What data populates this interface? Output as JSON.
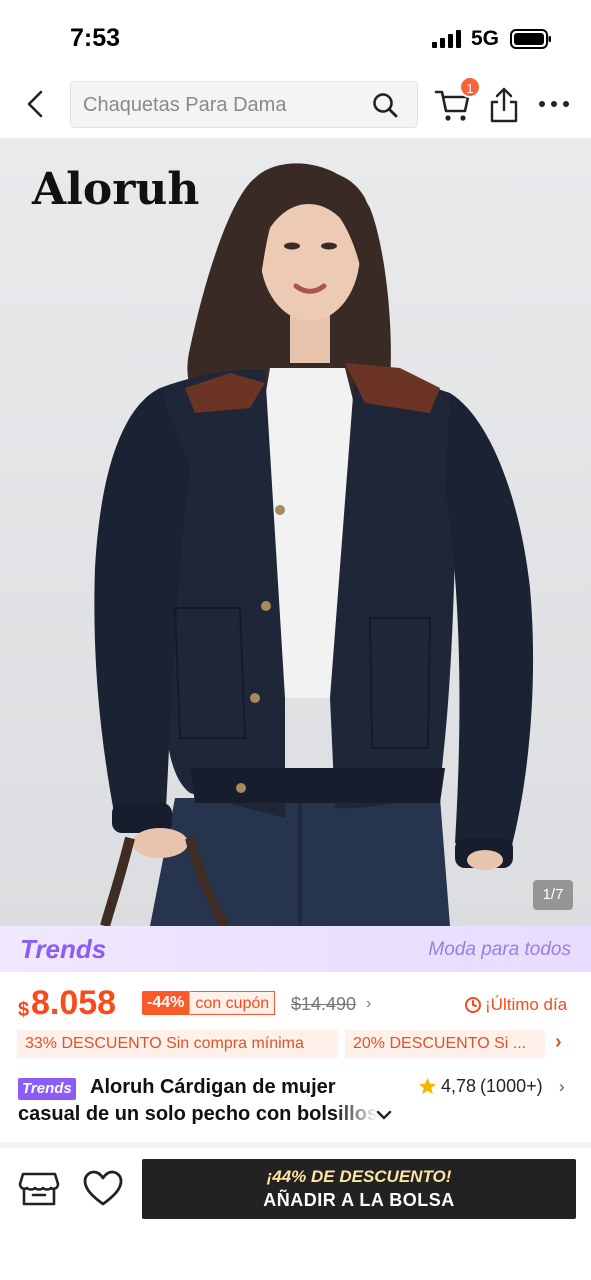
{
  "status_bar": {
    "time": "7:53",
    "network": "5G"
  },
  "header": {
    "search_placeholder": "Chaquetas Para Dama",
    "cart_count": "1"
  },
  "product_image": {
    "brand": "Aloruh",
    "counter": "1/7"
  },
  "trends_banner": {
    "logo": "Trends",
    "tagline": "Moda para todos"
  },
  "price": {
    "currency": "$",
    "value": "8.058",
    "discount_percent": "-44%",
    "discount_label": "con cupón",
    "old_price": "$14.490",
    "deadline": "¡Último día"
  },
  "coupons": [
    "33% DESCUENTO Sin compra mínima",
    "20% DESCUENTO Si ..."
  ],
  "title": {
    "badge": "Trends",
    "line1": "Aloruh Cárdigan de mujer",
    "line2": "casual de un solo pecho con bolsillos"
  },
  "rating": {
    "value": "4,78",
    "count": "(1000+)"
  },
  "bottom_bar": {
    "promo": "¡44% DE DESCUENTO!",
    "add_to_bag": "AÑADIR A LA BOLSA"
  },
  "colors": {
    "accent": "#fa4a1a",
    "trends_purple": "#8b5cf6",
    "button_dark": "#222222"
  }
}
